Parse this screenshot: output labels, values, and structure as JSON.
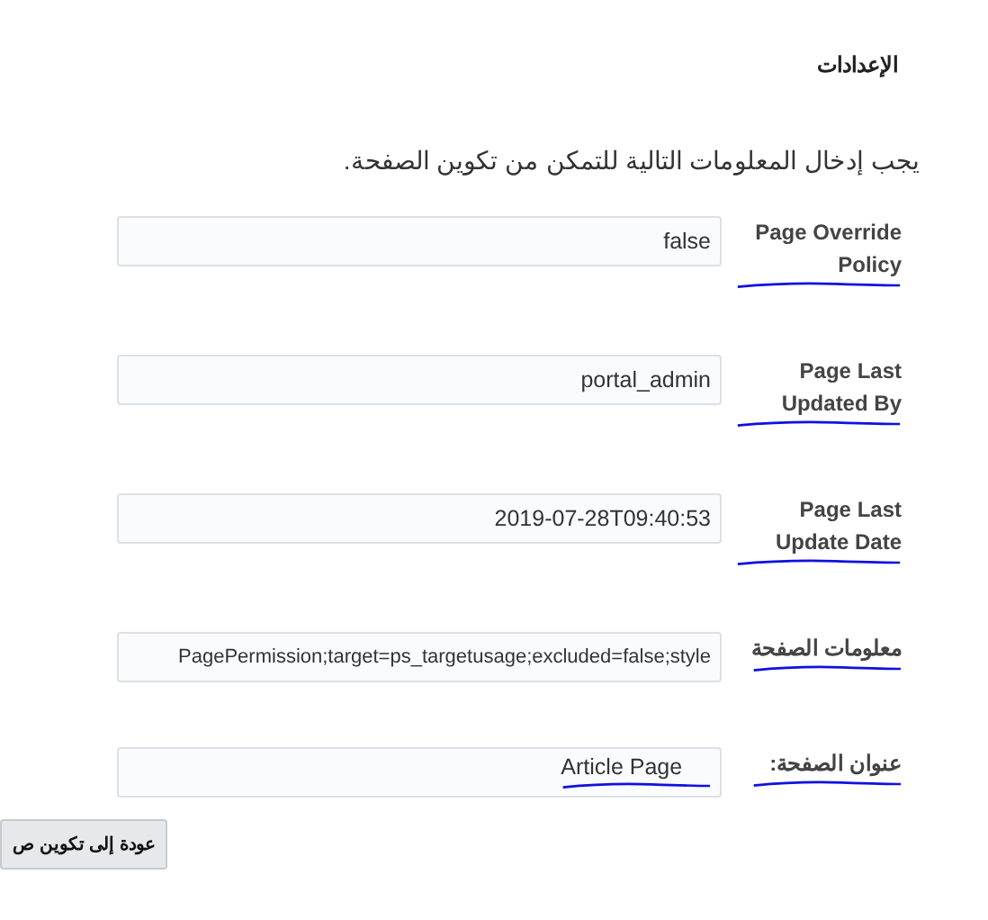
{
  "heading": "الإعدادات",
  "instruction": "يجب إدخال المعلومات التالية للتمكن من تكوين الصفحة.",
  "fields": [
    {
      "label": "Page Override Policy",
      "value": "false",
      "label_underlined": true,
      "value_underlined": false
    },
    {
      "label": "Page Last Updated By",
      "value": "portal_admin",
      "label_underlined": true,
      "value_underlined": false
    },
    {
      "label": "Page Last Update Date",
      "value": "2019-07-28T09:40:53",
      "label_underlined": true,
      "value_underlined": false
    },
    {
      "label": "معلومات الصفحة",
      "value": "PagePermission;target=ps_targetusage;excluded=false;style",
      "label_underlined": true,
      "value_underlined": false
    },
    {
      "label": "عنوان الصفحة:",
      "value": "Article Page",
      "label_underlined": true,
      "value_underlined": true
    }
  ],
  "back_button": "عودة إلى تكوين ص"
}
